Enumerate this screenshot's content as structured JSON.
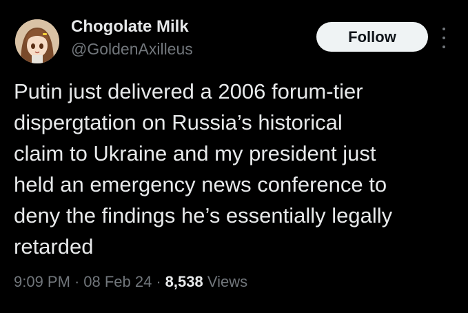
{
  "author": {
    "display_name": "Chogolate Milk",
    "handle": "@GoldenAxilleus",
    "avatar_icon": "anime-avatar"
  },
  "actions": {
    "follow_label": "Follow",
    "more_icon": "more-options-icon"
  },
  "tweet": {
    "lines": [
      "Putin just delivered a 2006 forum-tier",
      "dispergtation on Russia’s historical",
      "claim to Ukraine and my president just",
      "held an emergency news conference to",
      "deny the findings he’s essentially legally",
      "retarded"
    ]
  },
  "meta": {
    "time": "9:09 PM",
    "separator": "·",
    "date": "08 Feb 24",
    "views_count": "8,538",
    "views_label": "Views"
  },
  "colors": {
    "background": "#000000",
    "primary_text": "#e7e9ea",
    "secondary_text": "#71767b",
    "button_bg": "#eff3f4",
    "button_text": "#0f1419"
  }
}
